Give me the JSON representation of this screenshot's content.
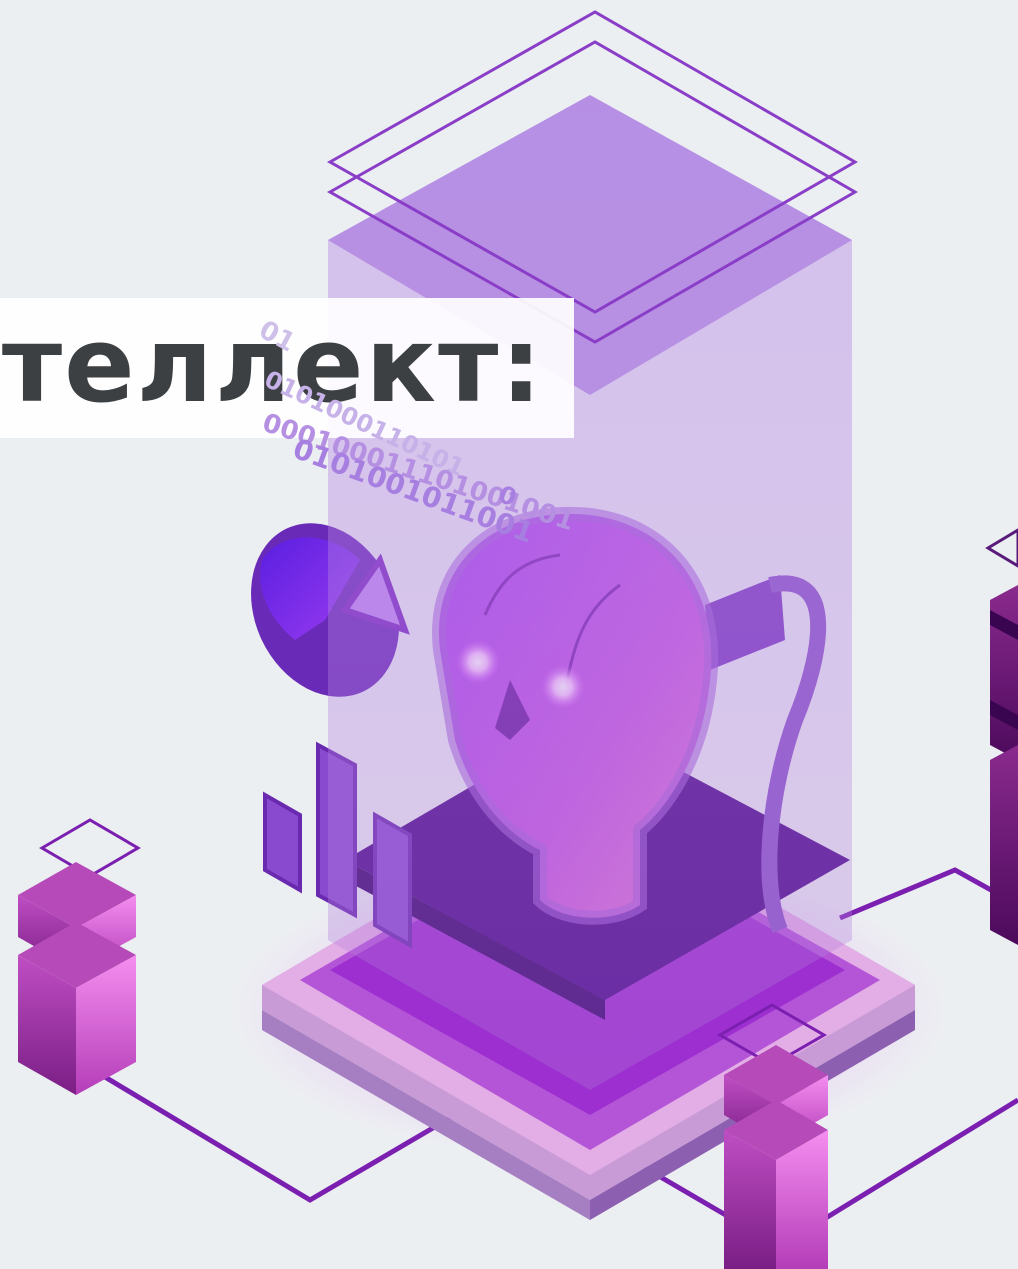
{
  "banner": {
    "title": "ителлект:"
  },
  "binary_strings": [
    "01",
    "0101000110101",
    "000100011101001001",
    "0101001011001",
    "0"
  ],
  "colors": {
    "background": "#eceff2",
    "title_text": "#3d4043",
    "banner_bg": "#ffffff",
    "purple_dark": "#4b0a8a",
    "purple_mid": "#8a2be2",
    "violet": "#9b59d6",
    "magenta": "#e05be8",
    "binary": "#a77fe0",
    "line": "#7b1fb0"
  },
  "icons": {
    "head": "robot-head-icon",
    "pie": "pie-chart-icon",
    "bars": "bar-chart-icon",
    "cubes": "isometric-cube-icon"
  }
}
